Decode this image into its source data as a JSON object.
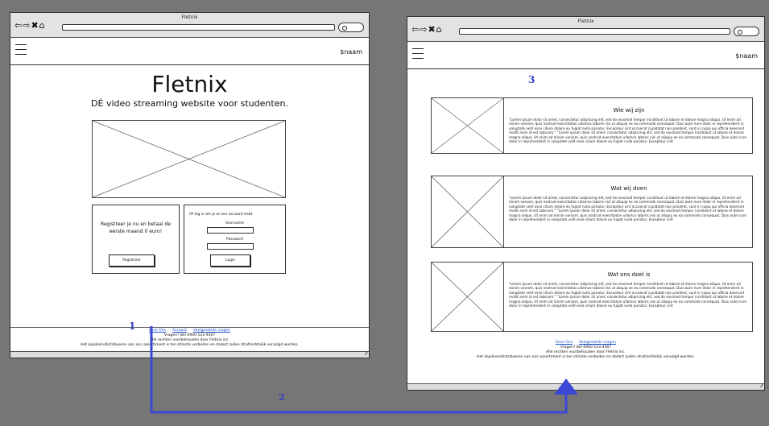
{
  "left_window": {
    "title": "Fletnix",
    "nav_icons": [
      "back-arrow-icon",
      "forward-arrow-icon",
      "close-icon",
      "home-icon"
    ],
    "header": {
      "user": "$naam"
    },
    "brand": "Fletnix",
    "tagline": "DÉ video streaming website voor studenten.",
    "register": {
      "text": "Registreer je nu en betaal de eerste maand 0 euro!",
      "button": "Registreer"
    },
    "login": {
      "intro": "Of log in als je al een account hebt",
      "username_label": "Username",
      "password_label": "Password",
      "button": "Login"
    },
    "footer": {
      "links": [
        "Over Ons",
        "Account",
        "Veelgestelde vragen"
      ],
      "phone": "Vragen? Bel 0900-123-4567",
      "rights": "Alle rechten voorbehouden door Fletnix inc.",
      "copyright": "Het kopiëren/distribueren van ons assortiment is ten strikste verboden en dadert zullen strafrechtelijk vervolgd worden."
    }
  },
  "right_window": {
    "title": "Fletnix",
    "header": {
      "user": "$naam"
    },
    "cards": [
      {
        "title": "Wie wij zijn",
        "text": "\"Lorem ipsum dolor sit amet, consectetur adipiscing elit, sed do eiusmod tempor incididunt ut labore et dolore magna aliqua. Ut enim ad minim veniam, quis nostrud exercitation ullamco laboris nisi ut aliquip ex ea commodo consequat. Duis aute irure dolor in reprehenderit in voluptate velit esse cillum dolore eu fugiat nulla pariatur. Excepteur sint occaecat cupidatat non proident, sunt in culpa qui officia deserunt mollit anim id est laborum.\" \"Lorem ipsum dolor sit amet, consectetur adipiscing elit, sed do eiusmod tempor incididunt ut labore et dolore magna aliqua. Ut enim ad minim veniam, quis nostrud exercitation ullamco laboris nisi ut aliquip ex ea commodo consequat. Duis aute irure dolor in reprehenderit in voluptate velit esse cillum dolore eu fugiat nulla pariatur. Excepteur sint"
      },
      {
        "title": "Wat wij doen",
        "text": "\"Lorem ipsum dolor sit amet, consectetur adipiscing elit, sed do eiusmod tempor incididunt ut labore et dolore magna aliqua. Ut enim ad minim veniam, quis nostrud exercitation ullamco laboris nisi ut aliquip ex ea commodo consequat. Duis aute irure dolor in reprehenderit in voluptate velit esse cillum dolore eu fugiat nulla pariatur. Excepteur sint occaecat cupidatat non proident, sunt in culpa qui officia deserunt mollit anim id est laborum.\" \"Lorem ipsum dolor sit amet, consectetur adipiscing elit, sed do eiusmod tempor incididunt ut labore et dolore magna aliqua. Ut enim ad minim veniam, quis nostrud exercitation ullamco laboris nisi ut aliquip ex ea commodo consequat. Duis aute irure dolor in reprehenderit in voluptate velit esse cillum dolore eu fugiat nulla pariatur. Excepteur sint"
      },
      {
        "title": "Wat ons doel is",
        "text": "\"Lorem ipsum dolor sit amet, consectetur adipiscing elit, sed do eiusmod tempor incididunt ut labore et dolore magna aliqua. Ut enim ad minim veniam, quis nostrud exercitation ullamco laboris nisi ut aliquip ex ea commodo consequat. Duis aute irure dolor in reprehenderit in voluptate velit esse cillum dolore eu fugiat nulla pariatur. Excepteur sint occaecat cupidatat non proident, sunt in culpa qui officia deserunt mollit anim id est laborum.\" \"Lorem ipsum dolor sit amet, consectetur adipiscing elit, sed do eiusmod tempor incididunt ut labore et dolore magna aliqua. Ut enim ad minim veniam, quis nostrud exercitation ullamco laboris nisi ut aliquip ex ea commodo consequat. Duis aute irure dolor in reprehenderit in voluptate velit esse cillum dolore eu fugiat nulla pariatur. Excepteur sint"
      }
    ],
    "footer": {
      "links": [
        "Over Ons",
        "Veelgestelde vragen"
      ],
      "phone": "Vragen? Bel 0900-123-4567",
      "rights": "Alle rechten voorbehouden door Fletnix inc.",
      "copyright": "Het kopiëren/distribueren van ons assortiment is ten strikste verboden en dadert zullen strafrechtelijk vervolgd worden."
    }
  },
  "annotations": {
    "step1": "1",
    "step2": "2",
    "step3": "3",
    "color": "#2f3fc2"
  },
  "colors": {
    "background": "#767676",
    "link": "#1a4fd6",
    "flow_arrow": "#3a48d4"
  }
}
